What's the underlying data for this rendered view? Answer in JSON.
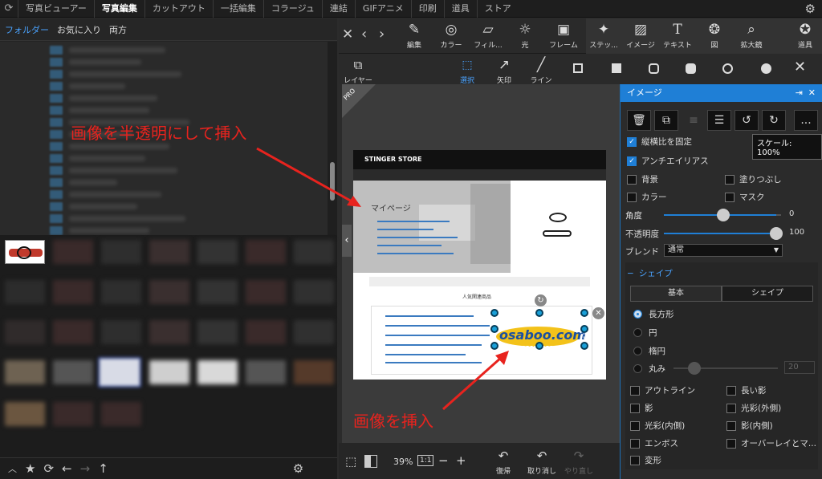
{
  "menu": {
    "items": [
      "写真ビューアー",
      "写真編集",
      "カットアウト",
      "一括編集",
      "コラージュ",
      "連結",
      "GIFアニメ",
      "印刷",
      "道具",
      "ストア"
    ],
    "active": "写真編集"
  },
  "left_tabs": [
    "フォルダー",
    "お気に入り",
    "両方"
  ],
  "toolbar": {
    "edit": "編集",
    "color": "カラー",
    "filter": "フィル...",
    "light": "光",
    "frame": "フレーム",
    "sticker": "ステッ...",
    "image": "イメージ",
    "text": "テキスト",
    "figure": "図",
    "zoom": "拡大鏡",
    "tools": "道具"
  },
  "subtools": {
    "layer": "レイヤー",
    "select": "選択",
    "arrow": "矢印",
    "line": "ライン"
  },
  "canvas": {
    "pro_badge": "PRO",
    "site_title": "STINGER STORE",
    "site_heading": "マイページ",
    "popular_heading": "人気関連商品",
    "logo_text": "osaboo.com"
  },
  "annotations": {
    "top": "画像を半透明にして挿入",
    "bottom": "画像を挿入"
  },
  "bottom_bar": {
    "zoom": "39%",
    "ratio": "1:1",
    "minus": "−",
    "plus": "+",
    "redo": "復帰",
    "undo": "取り消し",
    "redo2": "やり直し"
  },
  "image_panel": {
    "title": "イメージ",
    "scale_tooltip": "スケール: 100%",
    "more": "...",
    "keep_ratio": "縦横比を固定",
    "antialias": "アンチエイリアス",
    "background": "背景",
    "fill": "塗りつぶし",
    "color": "カラー",
    "mask": "マスク",
    "angle_label": "角度",
    "angle_value": "0",
    "opacity_label": "不透明度",
    "opacity_value": "100",
    "blend_label": "ブレンド",
    "blend_value": "通常",
    "shape_section": "シェイプ",
    "tab_basic": "基本",
    "tab_shape": "シェイプ",
    "shape_rect": "長方形",
    "shape_circle": "円",
    "shape_ellipse": "楕円",
    "shape_round": "丸み",
    "round_value": "20",
    "outline": "アウトライン",
    "long_shadow": "長い影",
    "shadow": "影",
    "glow_out": "光彩(外側)",
    "glow_in": "光彩(内側)",
    "shadow_in": "影(内側)",
    "emboss": "エンボス",
    "overlay": "オーバーレイとマ...",
    "deform": "変形"
  }
}
